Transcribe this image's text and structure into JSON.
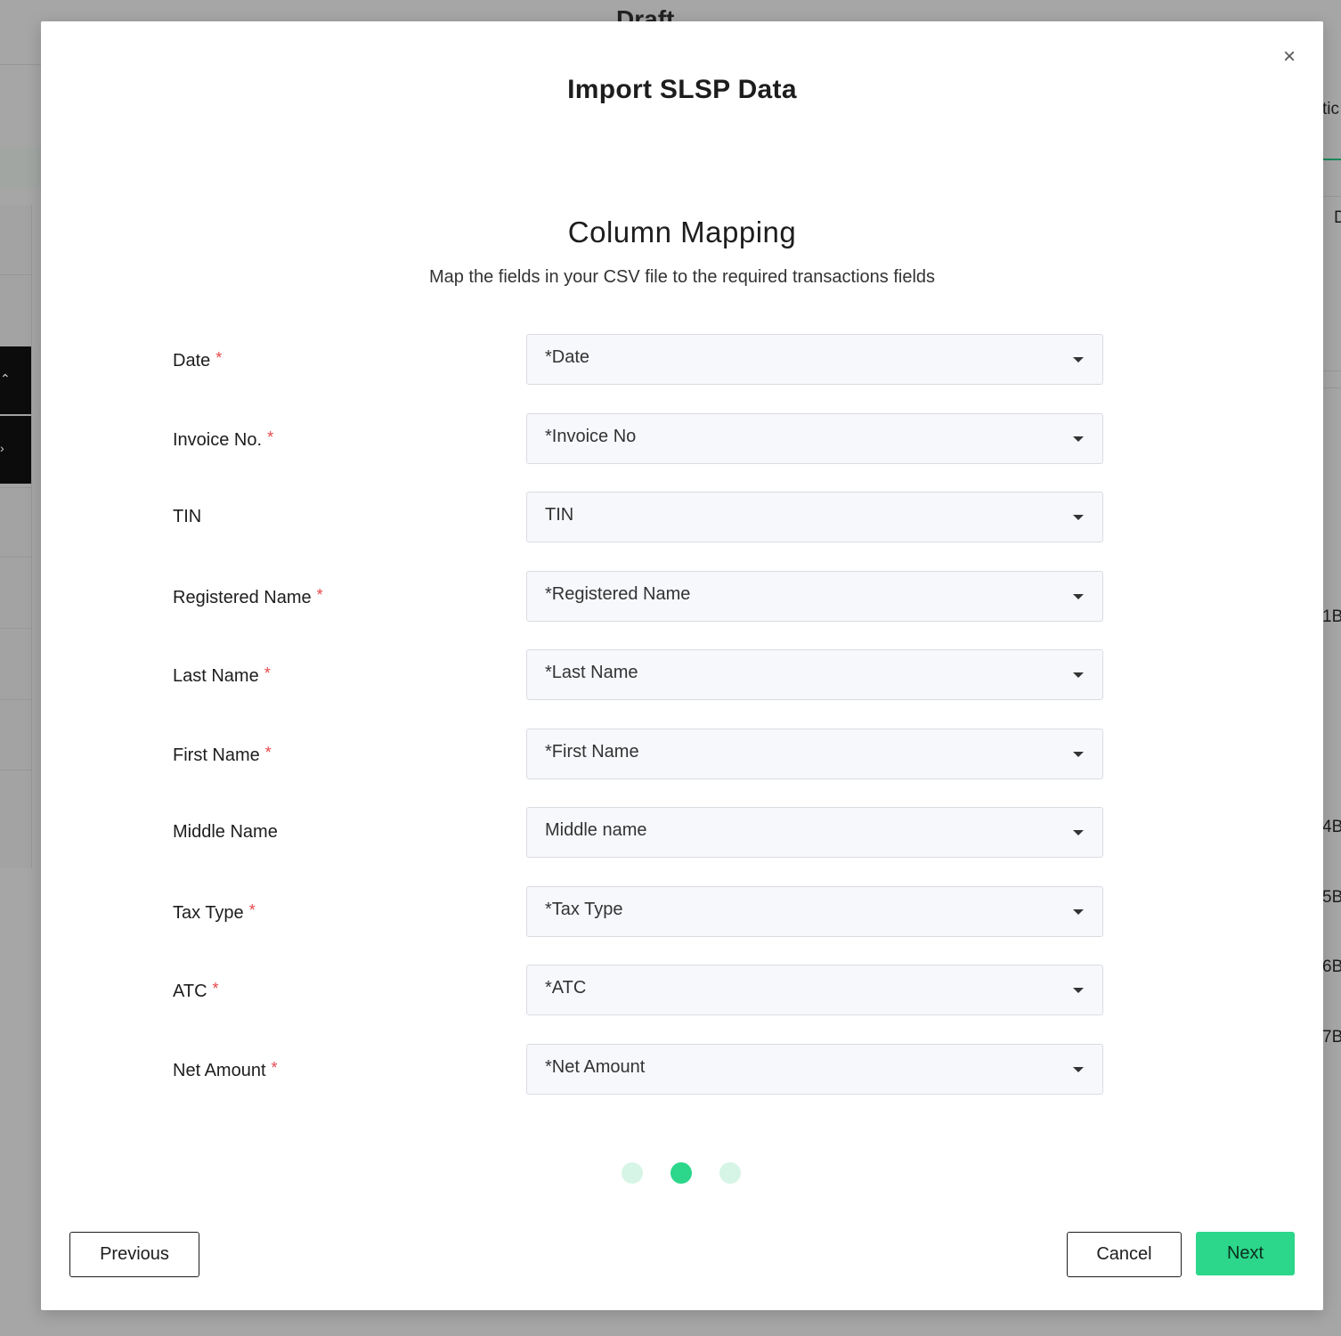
{
  "background": {
    "title": "Draft",
    "right_fragments": [
      "tic",
      "D",
      "1B",
      "4B",
      "5B",
      "6B",
      "7B"
    ]
  },
  "modal": {
    "title": "Import SLSP Data",
    "close_symbol": "×"
  },
  "step": {
    "title": "Column Mapping",
    "subtitle": "Map the fields in your CSV file to the required transactions fields"
  },
  "fields": [
    {
      "label": "Date",
      "required": true,
      "value": "*Date"
    },
    {
      "label": "Invoice No.",
      "required": true,
      "value": "*Invoice No"
    },
    {
      "label": "TIN",
      "required": false,
      "value": "TIN"
    },
    {
      "label": "Registered Name",
      "required": true,
      "value": "*Registered Name"
    },
    {
      "label": "Last Name",
      "required": true,
      "value": "*Last Name"
    },
    {
      "label": "First Name",
      "required": true,
      "value": "*First Name"
    },
    {
      "label": "Middle Name",
      "required": false,
      "value": "Middle name"
    },
    {
      "label": "Tax Type",
      "required": true,
      "value": "*Tax Type"
    },
    {
      "label": "ATC",
      "required": true,
      "value": "*ATC"
    },
    {
      "label": "Net Amount",
      "required": true,
      "value": "*Net Amount"
    }
  ],
  "required_marker": "*",
  "stepper": {
    "total": 3,
    "current": 2
  },
  "footer": {
    "previous_label": "Previous",
    "cancel_label": "Cancel",
    "next_label": "Next"
  },
  "colors": {
    "accent": "#2cd68a",
    "accent_light": "#d6f5e6",
    "required": "#e5484d"
  }
}
